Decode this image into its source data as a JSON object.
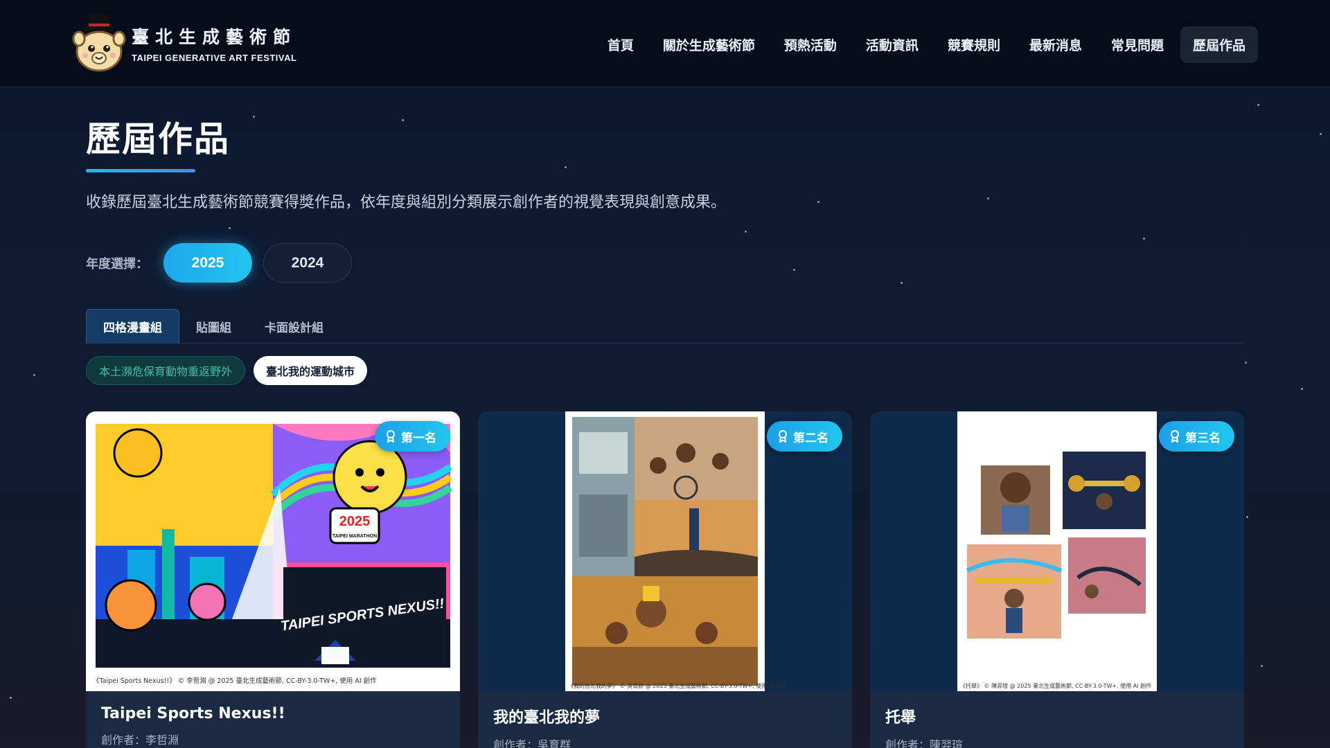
{
  "header": {
    "logo_zh": "臺北生成藝術節",
    "logo_en": "TAIPEI GENERATIVE ART FESTIVAL",
    "nav": [
      {
        "label": "首頁",
        "active": false
      },
      {
        "label": "關於生成藝術節",
        "active": false
      },
      {
        "label": "預熱活動",
        "active": false
      },
      {
        "label": "活動資訊",
        "active": false
      },
      {
        "label": "競賽規則",
        "active": false
      },
      {
        "label": "最新消息",
        "active": false
      },
      {
        "label": "常見問題",
        "active": false
      },
      {
        "label": "歷屆作品",
        "active": true
      }
    ]
  },
  "page": {
    "title": "歷屆作品",
    "description": "收錄歷屆臺北生成藝術節競賽得獎作品，依年度與組別分類展示創作者的視覺表現與創意成果。"
  },
  "year_filter": {
    "label": "年度選擇：",
    "years": [
      {
        "label": "2025",
        "active": true
      },
      {
        "label": "2024",
        "active": false
      }
    ]
  },
  "tabs": [
    {
      "label": "四格漫畫組",
      "active": true
    },
    {
      "label": "貼圖組",
      "active": false
    },
    {
      "label": "卡面設計組",
      "active": false
    }
  ],
  "themes": [
    {
      "label": "本土瀕危保育動物重返野外",
      "active": false
    },
    {
      "label": "臺北我的運動城市",
      "active": true
    }
  ],
  "cards": [
    {
      "rank": "第一名",
      "title": "Taipei Sports Nexus!!",
      "author": "創作者：李哲淵",
      "caption": "《Taipei Sports Nexus!!》 © 李哲淵 @ 2025 臺北生成藝術節, CC-BY-3.0-TW+, 使用 AI 創作",
      "art_text_1": "2025",
      "art_text_2": "TAIPEI MARATHON",
      "art_text_3": "TAIPEI SPORTS NEXUS!!"
    },
    {
      "rank": "第二名",
      "title": "我的臺北我的夢",
      "author": "創作者：吳育群",
      "caption": "《我的台北我的夢》 © 吳育群 @ 2025 臺北生成藝術節, CC-BY-3.0-TW+, 使用 AI 創作"
    },
    {
      "rank": "第三名",
      "title": "托舉",
      "author": "創作者：陳羿瑄",
      "caption": "《托舉》 © 陳羿瑄 @ 2025 臺北生成藝術節, CC-BY-3.0-TW+, 使用 AI 創作"
    }
  ],
  "icons": {
    "mascot": "alpaca-mascot-icon",
    "badge": "award-ribbon-icon"
  },
  "colors": {
    "accent": "#1fb8f0",
    "header_bg": "#060c1a",
    "tab_active": "#143a66",
    "theme_inactive_text": "#3fbfae"
  }
}
